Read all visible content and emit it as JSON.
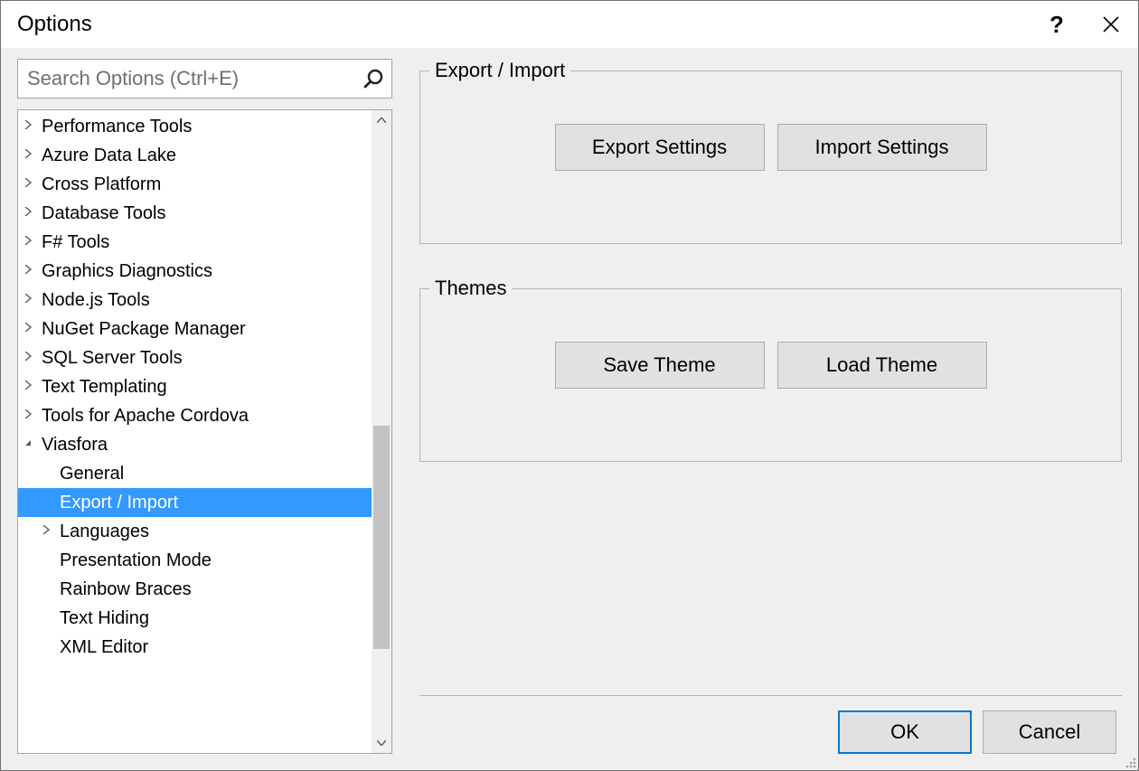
{
  "title": "Options",
  "search": {
    "placeholder": "Search Options (Ctrl+E)"
  },
  "tree": {
    "items": [
      {
        "label": "Performance Tools",
        "expanded": false,
        "level": 0,
        "hasChildren": true
      },
      {
        "label": "Azure Data Lake",
        "expanded": false,
        "level": 0,
        "hasChildren": true
      },
      {
        "label": "Cross Platform",
        "expanded": false,
        "level": 0,
        "hasChildren": true
      },
      {
        "label": "Database Tools",
        "expanded": false,
        "level": 0,
        "hasChildren": true
      },
      {
        "label": "F# Tools",
        "expanded": false,
        "level": 0,
        "hasChildren": true
      },
      {
        "label": "Graphics Diagnostics",
        "expanded": false,
        "level": 0,
        "hasChildren": true
      },
      {
        "label": "Node.js Tools",
        "expanded": false,
        "level": 0,
        "hasChildren": true
      },
      {
        "label": "NuGet Package Manager",
        "expanded": false,
        "level": 0,
        "hasChildren": true
      },
      {
        "label": "SQL Server Tools",
        "expanded": false,
        "level": 0,
        "hasChildren": true
      },
      {
        "label": "Text Templating",
        "expanded": false,
        "level": 0,
        "hasChildren": true
      },
      {
        "label": "Tools for Apache Cordova",
        "expanded": false,
        "level": 0,
        "hasChildren": true
      },
      {
        "label": "Viasfora",
        "expanded": true,
        "level": 0,
        "hasChildren": true
      },
      {
        "label": "General",
        "expanded": false,
        "level": 1,
        "hasChildren": false
      },
      {
        "label": "Export / Import",
        "expanded": false,
        "level": 1,
        "hasChildren": false,
        "selected": true
      },
      {
        "label": "Languages",
        "expanded": false,
        "level": 1,
        "hasChildren": true
      },
      {
        "label": "Presentation Mode",
        "expanded": false,
        "level": 1,
        "hasChildren": false
      },
      {
        "label": "Rainbow Braces",
        "expanded": false,
        "level": 1,
        "hasChildren": false
      },
      {
        "label": "Text Hiding",
        "expanded": false,
        "level": 1,
        "hasChildren": false
      },
      {
        "label": "XML Editor",
        "expanded": false,
        "level": 1,
        "hasChildren": false
      }
    ]
  },
  "groups": {
    "export_import": {
      "legend": "Export / Import",
      "buttons": {
        "export": "Export Settings",
        "import": "Import Settings"
      }
    },
    "themes": {
      "legend": "Themes",
      "buttons": {
        "save": "Save Theme",
        "load": "Load Theme"
      }
    }
  },
  "footer": {
    "ok": "OK",
    "cancel": "Cancel"
  }
}
